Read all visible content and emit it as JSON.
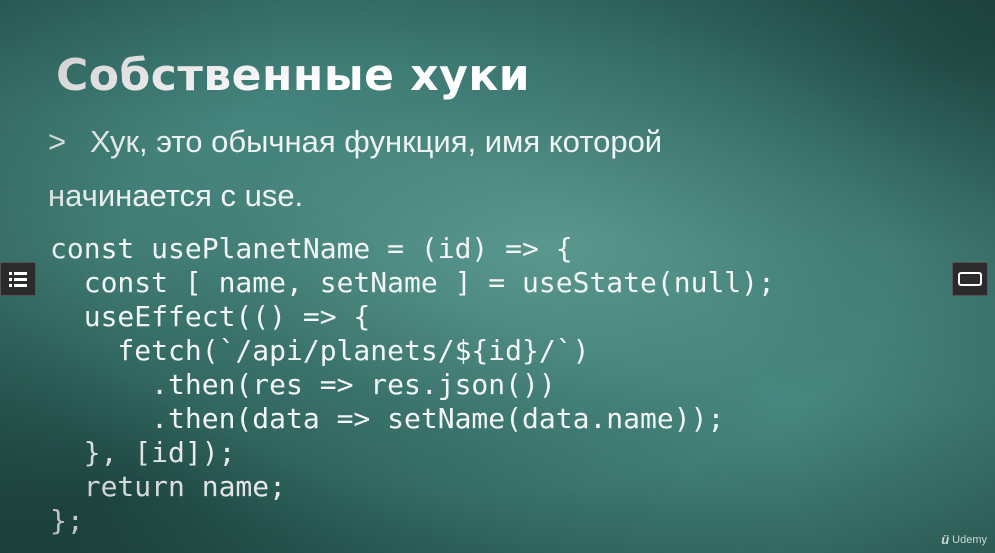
{
  "slide": {
    "title": "Собственные хуки",
    "bullet": {
      "marker": ">",
      "line1": "Хук, это обычная функция, имя которой",
      "line2": "начинается с use."
    },
    "code_lines": [
      "const usePlanetName = (id) => {",
      "  const [ name, setName ] = useState(null);",
      "  useEffect(() => {",
      "    fetch(`/api/planets/${id}/`)",
      "      .then(res => res.json())",
      "      .then(data => setName(data.name));",
      "  }, [id]);",
      "  return name;",
      "};"
    ]
  },
  "controls": {
    "left_button_icon": "list-icon",
    "right_button_icon": "fullscreen-icon"
  },
  "watermark": {
    "logo_icon": "udemy-logo-icon",
    "text": "Udemy"
  }
}
